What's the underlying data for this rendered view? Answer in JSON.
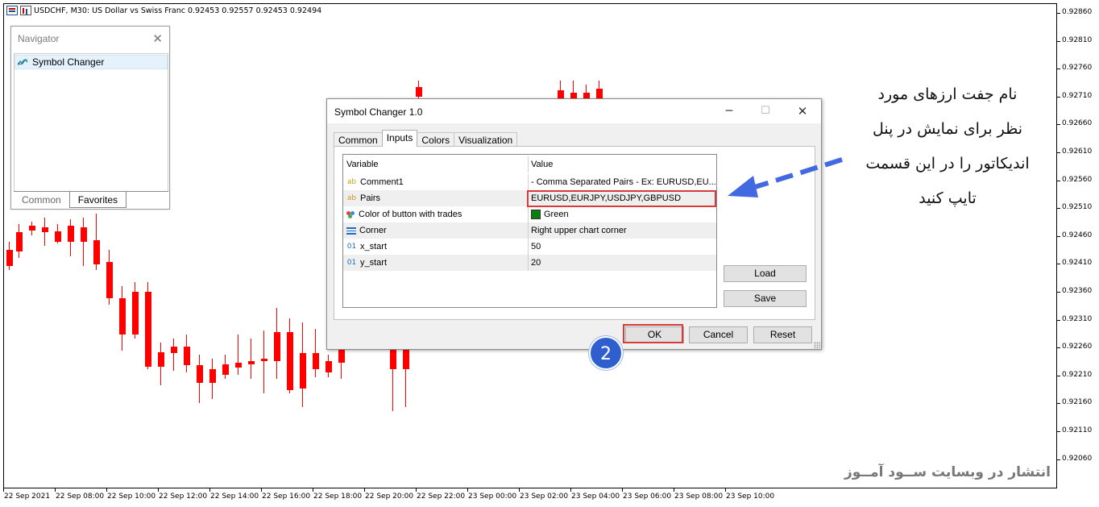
{
  "chart": {
    "symbol_title": "USDCHF, M30:  US Dollar vs Swiss Franc  0.92453 0.92557 0.92453 0.92494",
    "price_labels": [
      "0.92860",
      "0.92810",
      "0.92760",
      "0.92710",
      "0.92660",
      "0.92610",
      "0.92560",
      "0.92510",
      "0.92460",
      "0.92410",
      "0.92360",
      "0.92310",
      "0.92260",
      "0.92210",
      "0.92160",
      "0.92110",
      "0.92060"
    ],
    "time_labels": [
      "22 Sep 2021",
      "22 Sep 08:00",
      "22 Sep 10:00",
      "22 Sep 12:00",
      "22 Sep 14:00",
      "22 Sep 16:00",
      "22 Sep 18:00",
      "22 Sep 20:00",
      "22 Sep 22:00",
      "23 Sep 00:00",
      "23 Sep 02:00",
      "23 Sep 04:00",
      "23 Sep 06:00",
      "23 Sep 08:00",
      "23 Sep 10:00"
    ],
    "colors": {
      "bull": "#000000",
      "bear": "#ff0000"
    }
  },
  "navigator": {
    "title": "Navigator",
    "item": "Symbol Changer",
    "tabs": [
      "Common",
      "Favorites"
    ]
  },
  "dialog": {
    "title": "Symbol Changer 1.0",
    "tabs": [
      "Common",
      "Inputs",
      "Colors",
      "Visualization"
    ],
    "active_tab": "Inputs",
    "columns": {
      "variable": "Variable",
      "value": "Value"
    },
    "rows": [
      {
        "icon": "ab",
        "variable": "Comment1",
        "value": "- Comma Separated Pairs - Ex: EURUSD,EU..."
      },
      {
        "icon": "ab",
        "variable": "Pairs",
        "value": "EURUSD,EURJPY,USDJPY,GBPUSD"
      },
      {
        "icon": "palette",
        "variable": "Color of button with trades",
        "value": "Green",
        "swatch": "#0a7d0a"
      },
      {
        "icon": "list",
        "variable": "Corner",
        "value": "Right upper chart corner"
      },
      {
        "icon": "01",
        "variable": "x_start",
        "value": "50"
      },
      {
        "icon": "01",
        "variable": "y_start",
        "value": "20"
      }
    ],
    "buttons": {
      "load": "Load",
      "save": "Save",
      "ok": "OK",
      "cancel": "Cancel",
      "reset": "Reset"
    }
  },
  "annotation": {
    "badge": "2",
    "lines": [
      "نام جفت ارزهای مورد",
      "نظر برای نمایش در پنل",
      "اندیکاتور را در این قسمت",
      "تایپ کنید"
    ],
    "highlight_color": "#d93a3a",
    "arrow_color": "#4169e1"
  },
  "watermark": "انتشار در وبسایت   ســود آمــوز"
}
